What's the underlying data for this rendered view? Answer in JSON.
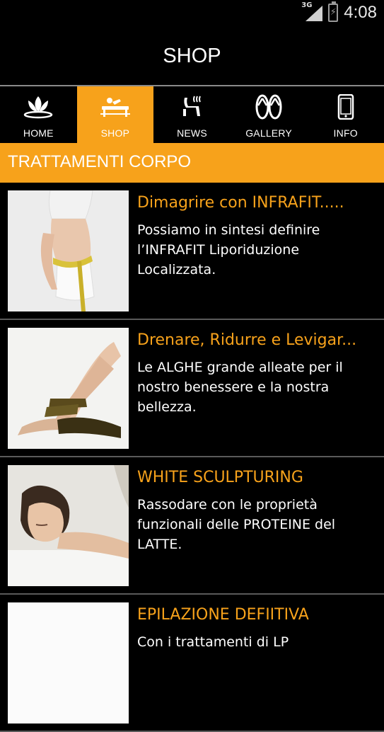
{
  "status_bar": {
    "network": "3G",
    "time": "4:08"
  },
  "title_bar": {
    "title": "SHOP"
  },
  "tabs": [
    {
      "label": "HOME",
      "icon": "lotus-icon",
      "active": false
    },
    {
      "label": "SHOP",
      "icon": "massage-icon",
      "active": true
    },
    {
      "label": "NEWS",
      "icon": "spa-chair-icon",
      "active": false
    },
    {
      "label": "GALLERY",
      "icon": "flip-flops-icon",
      "active": false
    },
    {
      "label": "INFO",
      "icon": "phone-icon",
      "active": false
    }
  ],
  "section": {
    "title": "TRATTAMENTI CORPO"
  },
  "items": [
    {
      "title": "Dimagrire con INFRAFIT.....",
      "description": "Possiamo in sintesi definire l’INFRAFIT Liporiduzione Localizzata."
    },
    {
      "title": "Drenare, Ridurre e Levigar...",
      "description": "Le ALGHE grande alleate per il nostro benessere e la nostra bellezza."
    },
    {
      "title": "WHITE SCULPTURING",
      "description": "Rassodare con le proprietà funzionali delle PROTEINE del LATTE."
    },
    {
      "title": "EPILAZIONE DEFIITIVA",
      "description": "Con i trattamenti di LP"
    }
  ],
  "colors": {
    "accent": "#f7a21b",
    "background": "#000000",
    "divider": "#5a5a5a"
  }
}
